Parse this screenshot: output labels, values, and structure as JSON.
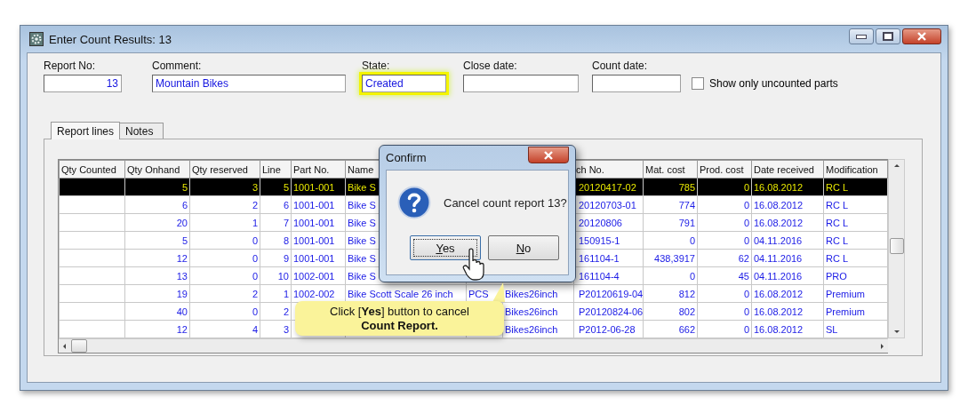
{
  "window": {
    "title": "Enter Count Results: 13"
  },
  "fields": [
    {
      "label": "Report No:",
      "value": "13",
      "highlighted": false
    },
    {
      "label": "Comment:",
      "value": "Mountain Bikes",
      "highlighted": false
    },
    {
      "label": "State:",
      "value": "Created",
      "highlighted": true
    },
    {
      "label": "Close date:",
      "highlighted": false
    },
    {
      "label": "Count date:",
      "highlighted": false
    }
  ],
  "checkbox": {
    "label": "Show only uncounted parts",
    "checked": false
  },
  "tabs": [
    {
      "label": "Report lines",
      "selected": true
    },
    {
      "label": "Notes",
      "selected": false
    }
  ],
  "table": {
    "columns": [
      "Qty Counted",
      "Qty Onhand",
      "Qty reserved",
      "Line",
      "Part No.",
      "Name",
      null,
      null,
      "ch No.",
      "Mat. cost",
      "Prod. cost",
      "Date received",
      "Modification"
    ],
    "rows": [
      {
        "selected": true,
        "cells": [
          null,
          "5",
          "3",
          "5",
          "1001-001",
          "Bike S",
          null,
          null,
          "20120417-02",
          "785",
          "0",
          "16.08.2012",
          "RC L"
        ]
      },
      {
        "selected": false,
        "cells": [
          null,
          "6",
          "2",
          "6",
          "1001-001",
          "Bike S",
          null,
          null,
          "20120703-01",
          "774",
          "0",
          "16.08.2012",
          "RC L"
        ]
      },
      {
        "selected": false,
        "cells": [
          null,
          "20",
          "1",
          "7",
          "1001-001",
          "Bike S",
          null,
          null,
          "20120806",
          "791",
          "0",
          "16.08.2012",
          "RC L"
        ]
      },
      {
        "selected": false,
        "cells": [
          null,
          "5",
          "0",
          "8",
          "1001-001",
          "Bike S",
          null,
          null,
          "150915-1",
          "0",
          "0",
          "04.11.2016",
          "RC L"
        ]
      },
      {
        "selected": false,
        "cells": [
          null,
          "12",
          "0",
          "9",
          "1001-001",
          "Bike S",
          null,
          null,
          "161104-1",
          "438,3917",
          "62",
          "04.11.2016",
          "RC L"
        ]
      },
      {
        "selected": false,
        "cells": [
          null,
          "13",
          "0",
          "10",
          "1002-001",
          "Bike S",
          null,
          null,
          "161104-4",
          "0",
          "45",
          "04.11.2016",
          "PRO"
        ]
      },
      {
        "selected": false,
        "cells": [
          null,
          "19",
          "2",
          "1",
          "1002-002",
          "Bike Scott Scale 26 inch",
          "PCS",
          "Bikes26inch",
          "P20120619-04",
          "812",
          "0",
          "16.08.2012",
          "Premium"
        ]
      },
      {
        "selected": false,
        "cells": [
          null,
          "40",
          "0",
          "2",
          null,
          null,
          null,
          "Bikes26inch",
          "P20120824-06",
          "802",
          "0",
          "16.08.2012",
          "Premium"
        ]
      },
      {
        "selected": false,
        "cells": [
          null,
          "12",
          "4",
          "3",
          null,
          null,
          null,
          "Bikes26inch",
          "P2012-06-28",
          "662",
          "0",
          "16.08.2012",
          "SL"
        ]
      }
    ]
  },
  "dialog": {
    "title": "Confirm",
    "message": "Cancel count report 13?",
    "buttons": [
      {
        "label": "Yes",
        "focused": true
      },
      {
        "label": "No",
        "focused": false
      }
    ]
  },
  "callout": {
    "text": "Click [**Yes**] button to cancel **Count Report.**"
  }
}
